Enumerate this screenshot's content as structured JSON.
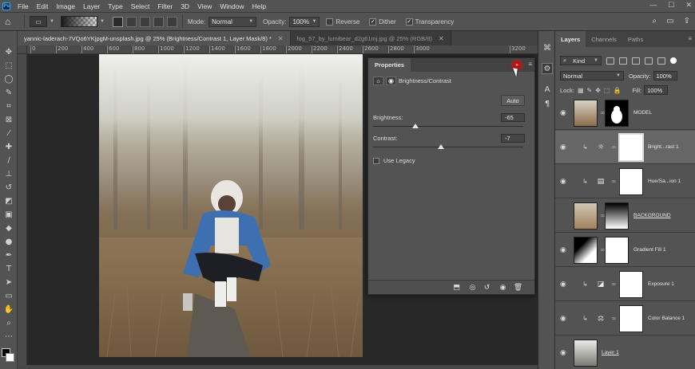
{
  "app": {
    "logo": "Ps",
    "menu": [
      "File",
      "Edit",
      "Image",
      "Layer",
      "Type",
      "Select",
      "Filter",
      "3D",
      "View",
      "Window",
      "Help"
    ]
  },
  "options_bar": {
    "mode_label": "Mode:",
    "mode_value": "Normal",
    "opacity_label": "Opacity:",
    "opacity_value": "100%",
    "reverse_label": "Reverse",
    "dither_label": "Dither",
    "transparency_label": "Transparency",
    "reverse_checked": false,
    "dither_checked": true,
    "transparency_checked": true
  },
  "tabs": [
    {
      "label": "yannic-laderach-7VQo6YKjpgM-unsplash.jpg @ 25% (Brightness/Contrast 1, Layer Mask/8) *",
      "active": true
    },
    {
      "label": "fog_57_by_lumibear_d2g61mj.jpg @ 25% (RGB/8)",
      "active": false
    }
  ],
  "ruler": {
    "ticks": [
      "0",
      "200",
      "400",
      "600",
      "800",
      "1000",
      "1200",
      "1400",
      "1600",
      "1800",
      "2000",
      "2200",
      "2400",
      "2600",
      "2800",
      "3000",
      "3200"
    ]
  },
  "properties": {
    "tab": "Properties",
    "type_label": "Brightness/Contrast",
    "auto_label": "Auto",
    "brightness_label": "Brightness:",
    "brightness_value": "-65",
    "brightness_fraction": 0.28,
    "contrast_label": "Contrast:",
    "contrast_value": "-7",
    "contrast_fraction": 0.45,
    "legacy_label": "Use Legacy",
    "legacy_checked": false
  },
  "layers_panel": {
    "tabs": [
      "Layers",
      "Channels",
      "Paths"
    ],
    "kind_label": "Kind",
    "blend_mode": "Normal",
    "opacity_label": "Opacity:",
    "opacity_value": "100%",
    "lock_label": "Lock:",
    "fill_label": "Fill:",
    "fill_value": "100%",
    "layers": [
      {
        "name": "MODEL",
        "type": "image-mask",
        "selected": false
      },
      {
        "name": "Bright...rast 1",
        "type": "brightness-contrast",
        "selected": true
      },
      {
        "name": "Hue/Sa...ion 1",
        "type": "hue-saturation",
        "selected": false
      },
      {
        "name": "BACKGROUND",
        "type": "image-gradient-mask",
        "selected": false
      },
      {
        "name": "Gradient Fill 1",
        "type": "gradient-fill",
        "selected": false
      },
      {
        "name": "Exposure 1",
        "type": "exposure",
        "selected": false
      },
      {
        "name": "Color Balance 1",
        "type": "color-balance",
        "selected": false
      },
      {
        "name": "Layer 1",
        "type": "image",
        "selected": false
      }
    ]
  },
  "colors": {
    "accent": "#31a8ff",
    "panel": "#535353",
    "dark": "#282828",
    "highlight_circle": "#b71414"
  }
}
